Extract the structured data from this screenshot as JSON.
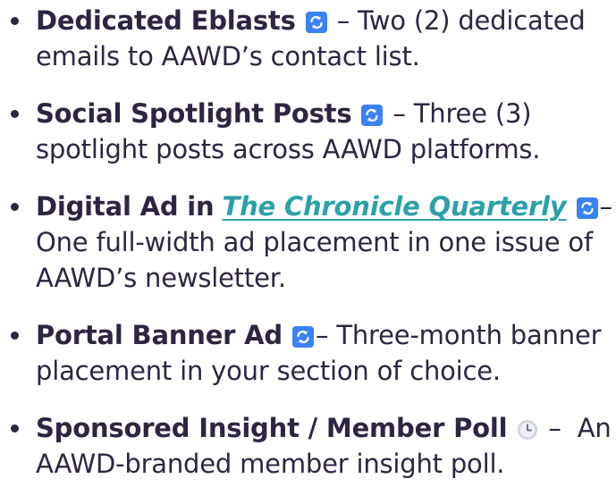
{
  "items": [
    {
      "label": "Dedicated Eblasts",
      "icon": "repeat-icon",
      "separator": " – ",
      "description": "Two (2) dedicated emails to AAWD’s contact list."
    },
    {
      "label": "Social Spotlight Posts",
      "icon": "repeat-icon",
      "separator": " – ",
      "description": "Three (3) spotlight posts across AAWD platforms."
    },
    {
      "label": "Digital Ad in",
      "link_text": "The Chronicle Quarterly",
      "icon": "repeat-icon",
      "separator": "– ",
      "description": "One full-width ad placement in one issue of AAWD’s newsletter."
    },
    {
      "label": "Portal Banner Ad",
      "icon": "repeat-icon",
      "separator": "– ",
      "description": "Three-month banner placement in your section of choice."
    },
    {
      "label": "Sponsored Insight / Member Poll",
      "icon": "clock-icon",
      "separator": " –  ",
      "description": "An AAWD-branded member insight poll."
    }
  ],
  "colors": {
    "text": "#2f2541",
    "link": "#2ba1a8",
    "repeat_icon_bg": "#3b82f6",
    "clock_icon_bg": "#cdd2dc"
  }
}
